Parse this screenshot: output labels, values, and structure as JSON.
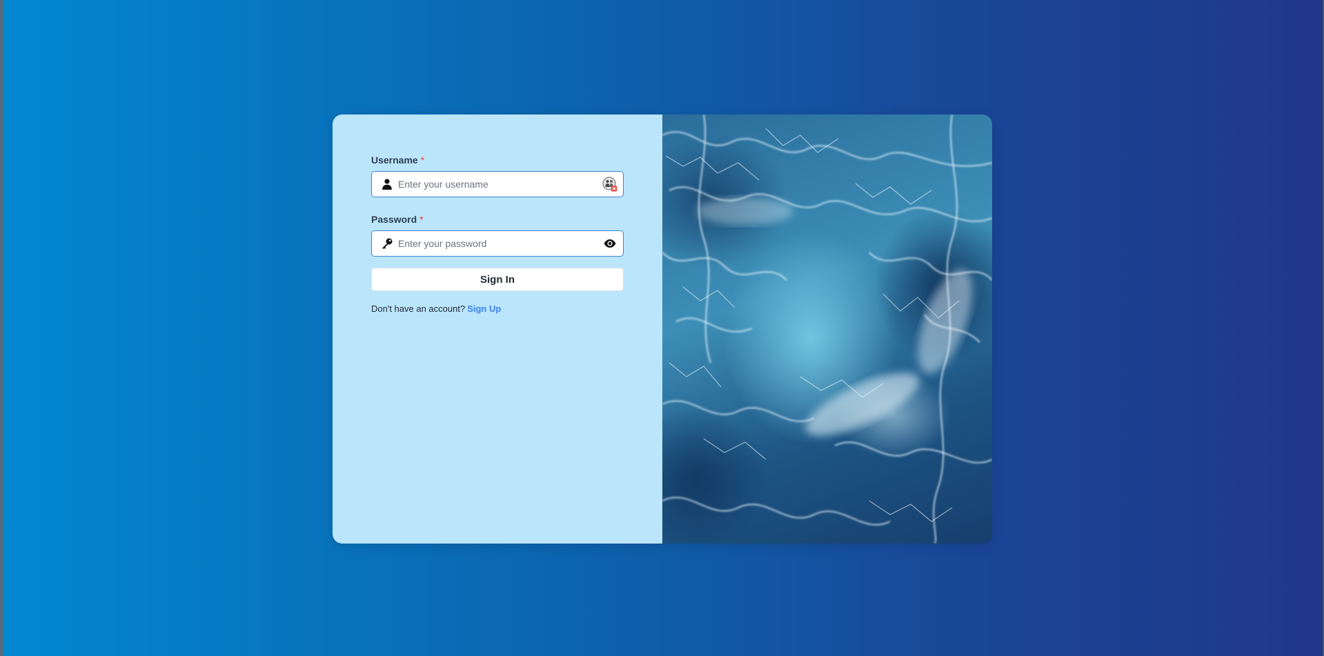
{
  "login": {
    "username": {
      "label": "Username",
      "required_mark": "*",
      "placeholder": "Enter your username",
      "value": ""
    },
    "password": {
      "label": "Password",
      "required_mark": "*",
      "placeholder": "Enter your password",
      "value": ""
    },
    "sign_in_label": "Sign In",
    "signup_prompt": "Don't have an account?",
    "signup_link": "Sign Up"
  },
  "icons": {
    "username_leading": "user-icon",
    "username_trailing": "password-manager-icon",
    "password_leading": "key-icon",
    "password_trailing": "eye-icon"
  },
  "colors": {
    "background_start": "#0288d1",
    "background_end": "#21378a",
    "form_panel": "#bbe5fa",
    "input_border": "#3b82d6",
    "required": "#e53935",
    "link": "#3b82f6"
  }
}
